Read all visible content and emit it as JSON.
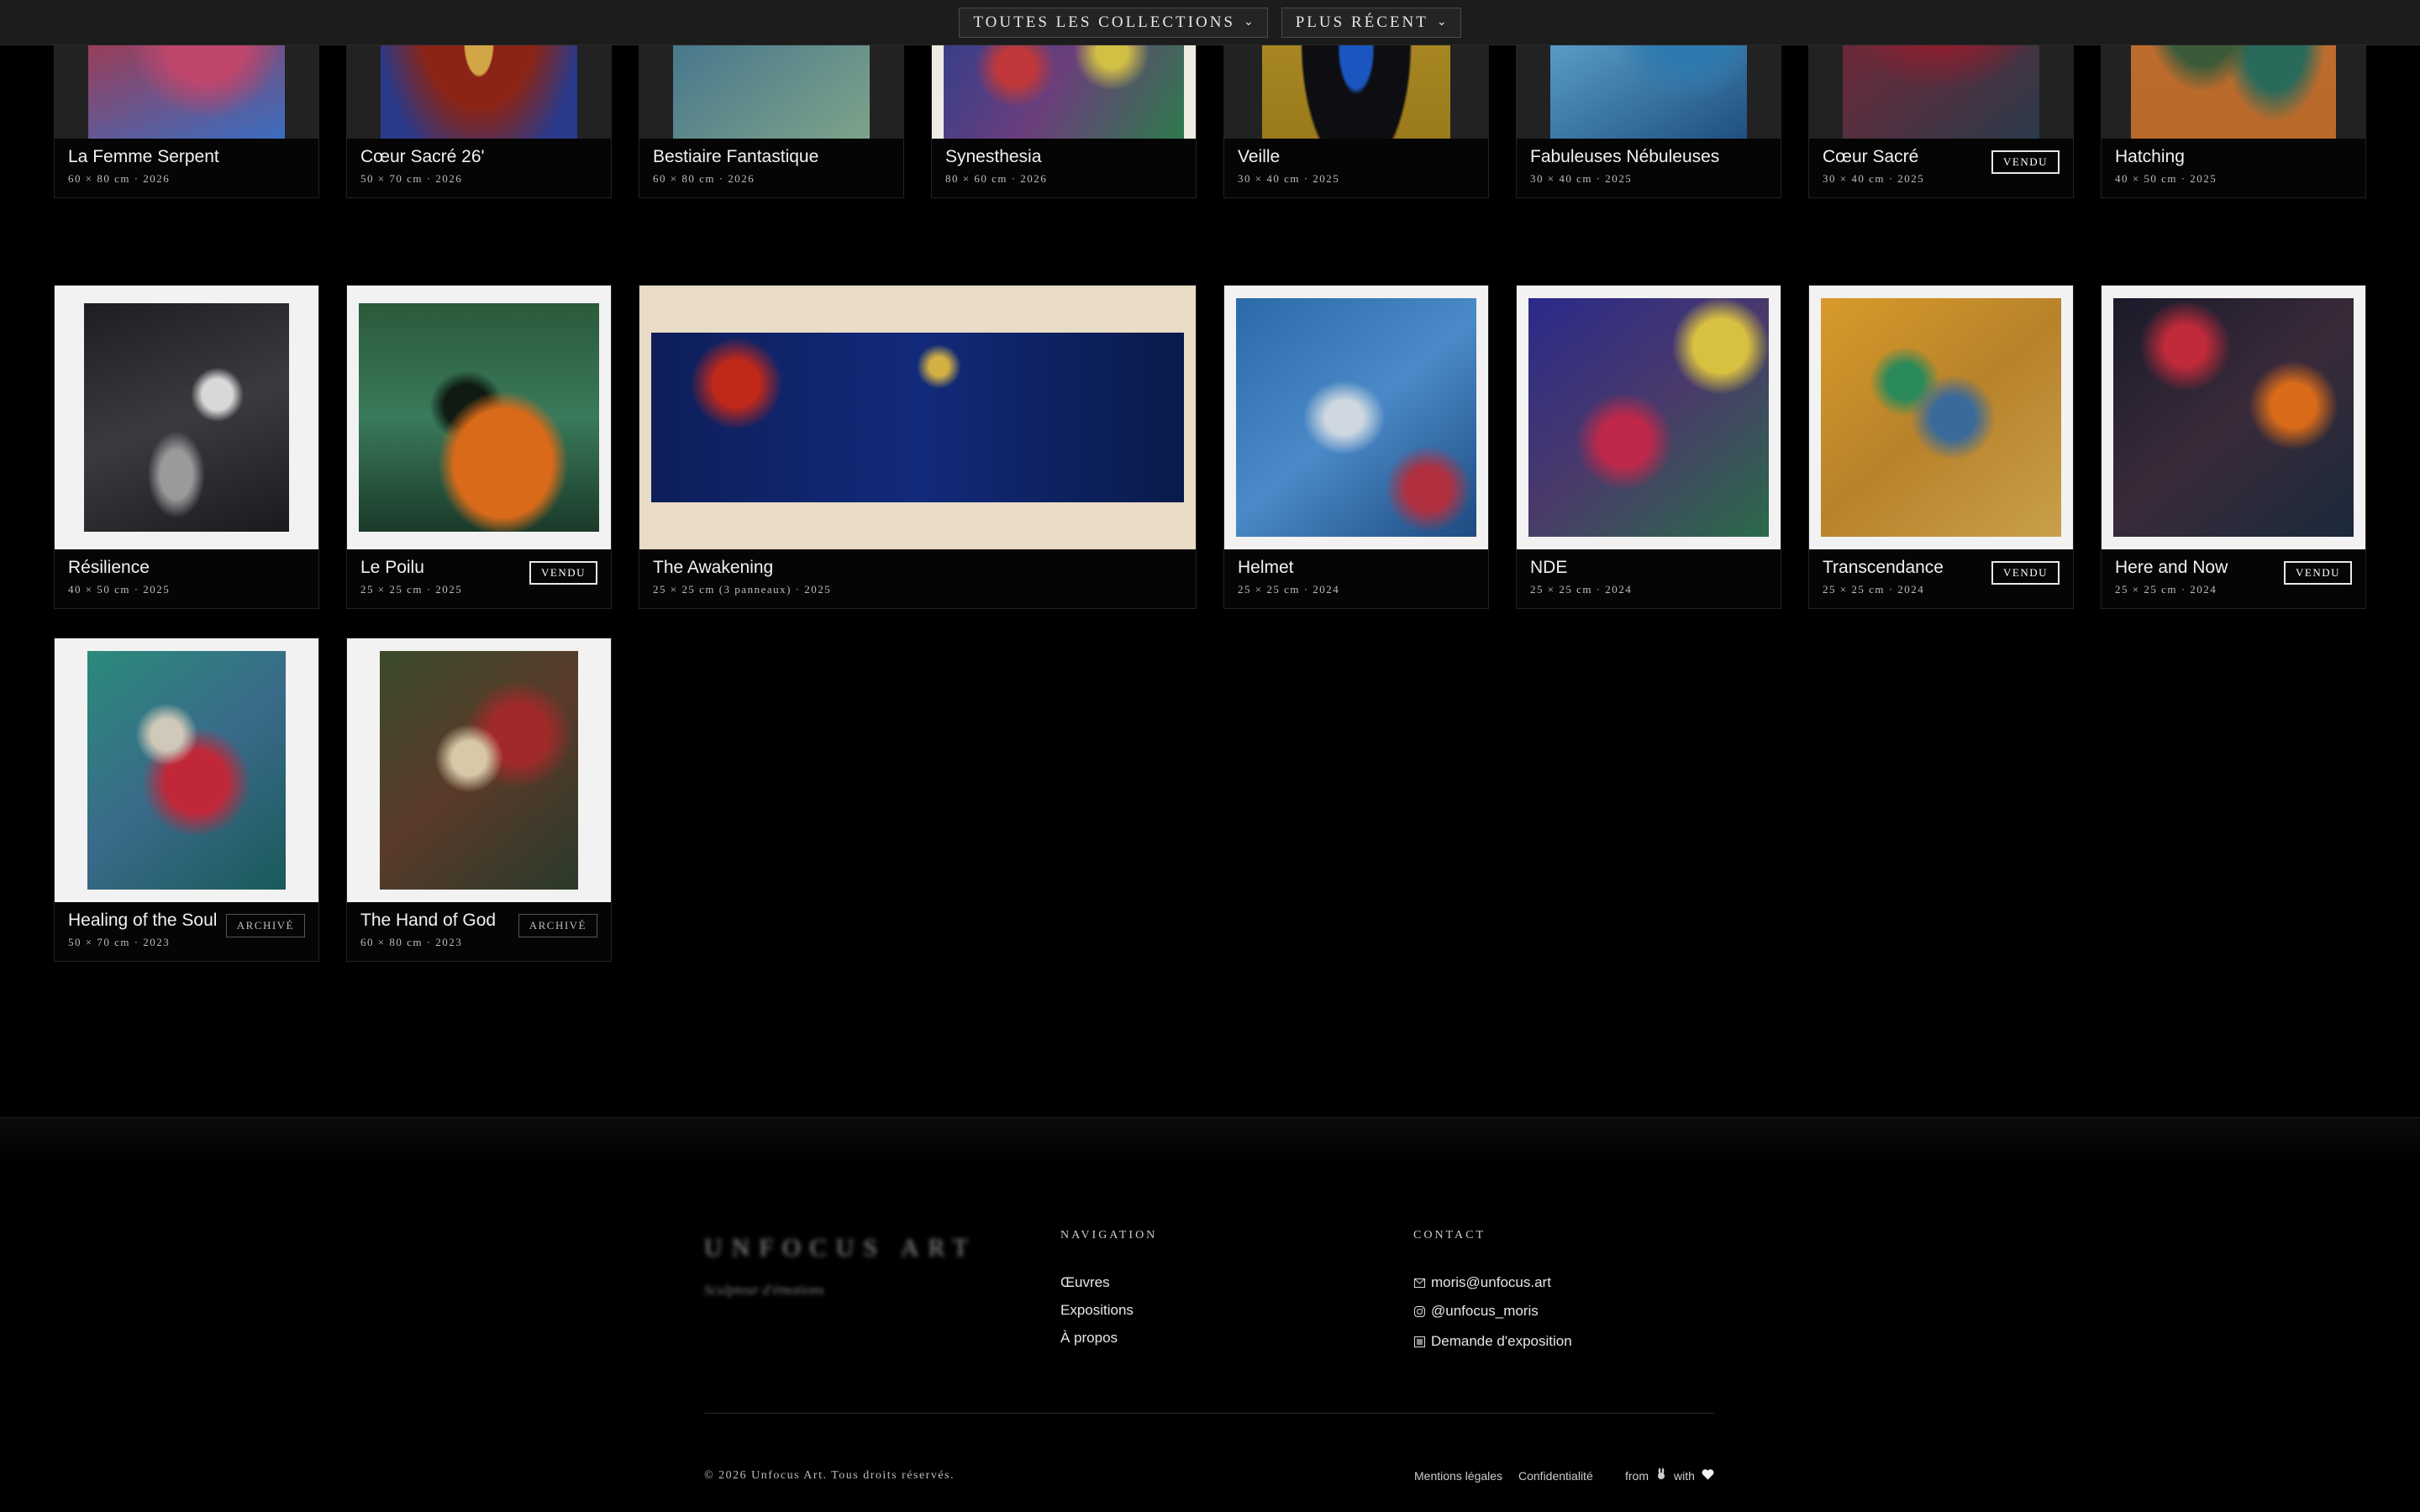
{
  "filters": {
    "collection_label": "TOUTES LES COLLECTIONS",
    "sort_label": "PLUS RÉCENT"
  },
  "artworks": [
    {
      "title": "La Femme Serpent",
      "dims": "60 × 80 cm · 2026",
      "badge": "",
      "art": "serpent"
    },
    {
      "title": "Cœur Sacré 26'",
      "dims": "50 × 70 cm · 2026",
      "badge": "",
      "art": "coeur26"
    },
    {
      "title": "Bestiaire Fantastique",
      "dims": "60 × 80 cm · 2026",
      "badge": "",
      "art": "bestiaire"
    },
    {
      "title": "Synesthesia",
      "dims": "80 × 60 cm · 2026",
      "badge": "",
      "art": "synesthesia"
    },
    {
      "title": "Veille",
      "dims": "30 × 40 cm · 2025",
      "badge": "",
      "art": "veille"
    },
    {
      "title": "Fabuleuses Nébuleuses",
      "dims": "30 × 40 cm · 2025",
      "badge": "",
      "art": "nebuleuses"
    },
    {
      "title": "Cœur Sacré",
      "dims": "30 × 40 cm · 2025",
      "badge": "VENDU",
      "art": "coeursacre"
    },
    {
      "title": "Hatching",
      "dims": "40 × 50 cm · 2025",
      "badge": "",
      "art": "hatching"
    },
    {
      "title": "Résilience",
      "dims": "40 × 50 cm · 2025",
      "badge": "",
      "art": "resilience"
    },
    {
      "title": "Le Poilu",
      "dims": "25 × 25 cm · 2025",
      "badge": "VENDU",
      "art": "poilu"
    },
    {
      "title": "The Awakening",
      "dims": "25 × 25 cm (3 panneaux) · 2025",
      "badge": "",
      "art": "awakening"
    },
    {
      "title": "Helmet",
      "dims": "25 × 25 cm · 2024",
      "badge": "",
      "art": "helmet"
    },
    {
      "title": "NDE",
      "dims": "25 × 25 cm · 2024",
      "badge": "",
      "art": "nde"
    },
    {
      "title": "Transcendance",
      "dims": "25 × 25 cm · 2024",
      "badge": "VENDU",
      "art": "transcendance"
    },
    {
      "title": "Here and Now",
      "dims": "25 × 25 cm · 2024",
      "badge": "VENDU",
      "art": "herenow"
    },
    {
      "title": "Healing of the Soul",
      "dims": "50 × 70 cm · 2023",
      "badge": "ARCHIVÉ",
      "art": "healing"
    },
    {
      "title": "The Hand of God",
      "dims": "60 × 80 cm · 2023",
      "badge": "ARCHIVÉ",
      "art": "handofgod"
    }
  ],
  "footer": {
    "brand": "UNFOCUS ART",
    "tagline": "Sculpteur d'émotions",
    "nav_heading": "NAVIGATION",
    "nav": [
      "Œuvres",
      "Expositions",
      "À propos"
    ],
    "contact_heading": "CONTACT",
    "email": "moris@unfocus.art",
    "instagram": "@unfocus_moris",
    "request": "Demande d'exposition",
    "copyright": "© 2026 Unfocus Art. Tous droits réservés.",
    "legal": "Mentions légales",
    "privacy": "Confidentialité",
    "from": "from",
    "with": "with"
  },
  "icons": {
    "filter_chevron": "chevron-down-icon",
    "mail": "mail-icon",
    "instagram": "instagram-icon",
    "request": "frame-icon",
    "heart": "heart-icon"
  }
}
